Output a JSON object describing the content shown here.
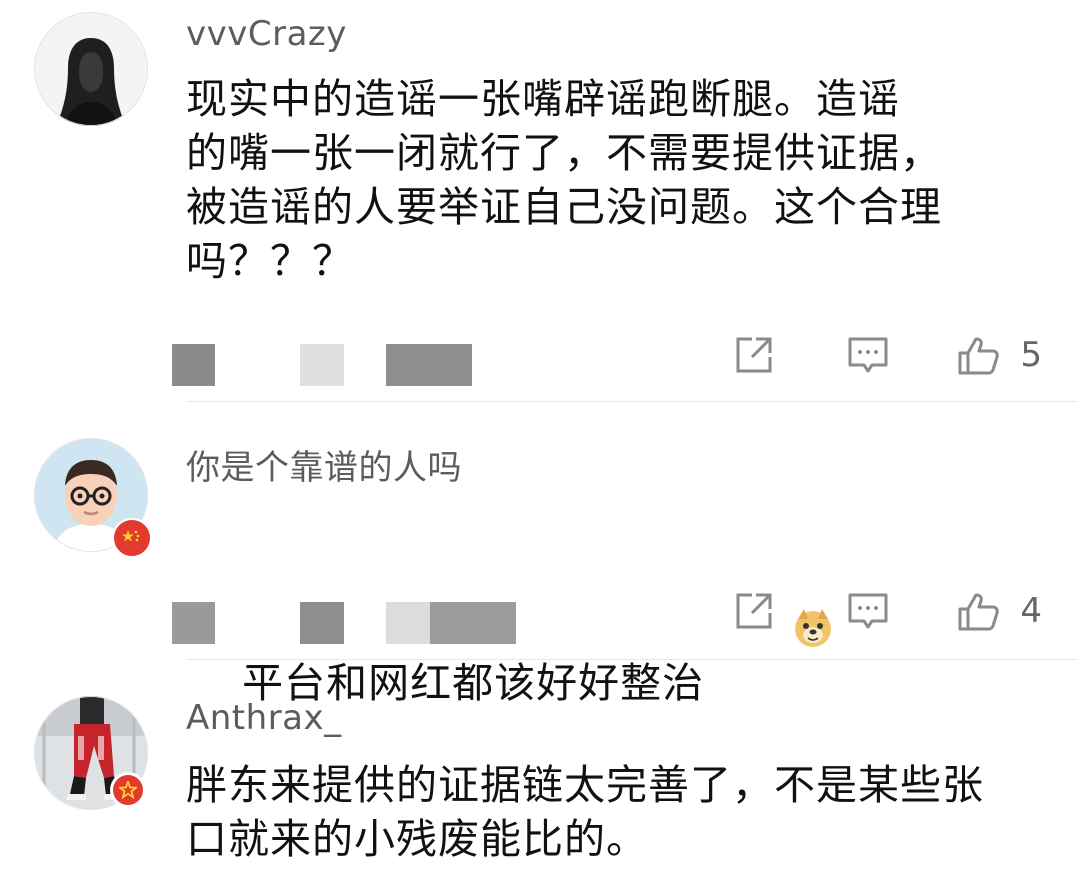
{
  "comments": [
    {
      "username": "vvvCrazy",
      "text": "现实中的造谣一张嘴辟谣跑断腿。造谣\n的嘴一张一闭就行了，不需要提供证据，\n被造谣的人要举证自己没问题。这个合理\n吗？？？",
      "likes": "5",
      "avatar_icon": "portrait-dark-hair-avatar"
    },
    {
      "username": "你是个靠谱的人吗",
      "text": "平台和网红都该好好整治",
      "emoji_icon": "doge-emoji-icon",
      "likes": "4",
      "avatar_icon": "cartoon-man-glasses-avatar",
      "badge_icon": "china-flag-badge"
    },
    {
      "username": "Anthrax_",
      "text": "胖东来提供的证据链太完善了，不是某些张\n口就来的小残废能比的。",
      "avatar_icon": "person-red-pants-avatar",
      "badge_icon": "red-star-badge"
    }
  ],
  "icons": {
    "share": "share-icon",
    "reply": "comment-icon",
    "like": "thumbs-up-icon"
  },
  "colors": {
    "text": "#111111",
    "username": "#5c5c5c",
    "icon": "#8a8a8a",
    "badge_red": "#e23a2e"
  }
}
